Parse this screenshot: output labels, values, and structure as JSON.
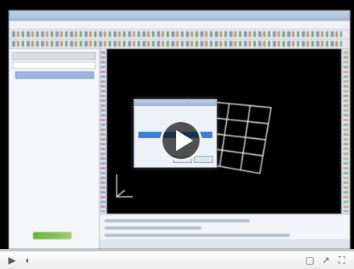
{
  "player": {
    "play_icon": "play-icon",
    "progress": 0.0
  },
  "controls": {
    "play_icon": "play-icon",
    "volume_icon": "volume-icon",
    "cc_icon": "captions-icon",
    "popout_icon": "popout-icon",
    "fullscreen_icon": "fullscreen-icon",
    "glyphs": {
      "play": "▶",
      "volume": "◐",
      "cc": "▢",
      "popout": "↗",
      "fullscreen": "⛶"
    }
  },
  "colors": {
    "progress_fill": "#cc1d1d",
    "viewport_bg": "#000000",
    "dialog_selection": "#3b7fd6"
  }
}
